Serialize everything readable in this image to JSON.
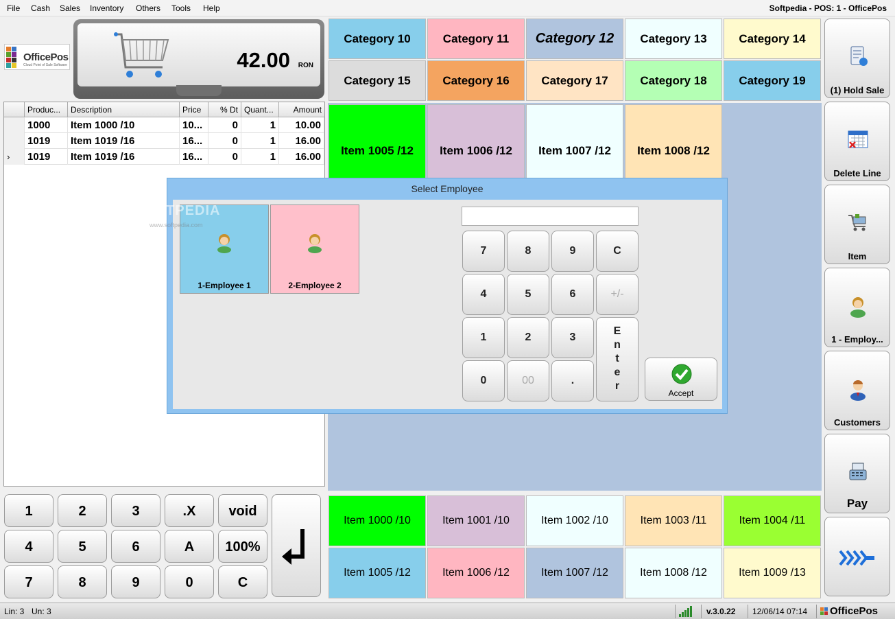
{
  "window_title": "Softpedia - POS: 1 - OfficePos",
  "menu": [
    {
      "label": "File"
    },
    {
      "label": "Cash"
    },
    {
      "label": "Sales"
    },
    {
      "label": "Inventory"
    },
    {
      "label": "Others"
    },
    {
      "label": "Tools"
    },
    {
      "label": "Help"
    }
  ],
  "logo": {
    "text": "OfficePos",
    "tagline": "Cloud Point of Sale Software"
  },
  "display": {
    "total": "42.00",
    "currency": "RON"
  },
  "grid": {
    "columns": [
      "Produc...",
      "Description",
      "Price",
      "% Dt",
      "Quant...",
      "Amount"
    ],
    "rows": [
      {
        "marker": "",
        "product": "1000",
        "description": "Item 1000 /10",
        "price": "10...",
        "discount": "0",
        "qty": "1",
        "amount": "10.00"
      },
      {
        "marker": "",
        "product": "1019",
        "description": "Item 1019 /16",
        "price": "16...",
        "discount": "0",
        "qty": "1",
        "amount": "16.00"
      },
      {
        "marker": "›",
        "product": "1019",
        "description": "Item 1019 /16",
        "price": "16...",
        "discount": "0",
        "qty": "1",
        "amount": "16.00"
      }
    ]
  },
  "keypad": [
    "1",
    "2",
    "3",
    ".X",
    "void",
    "4",
    "5",
    "6",
    "A",
    "100%",
    "7",
    "8",
    "9",
    "0",
    "C"
  ],
  "categories": [
    {
      "label": "Category 10",
      "color": "#87ceeb"
    },
    {
      "label": "Category 11",
      "color": "#ffb6c1"
    },
    {
      "label": "Category 12",
      "color": "#b0c4de"
    },
    {
      "label": "Category 13",
      "color": "#f0ffff"
    },
    {
      "label": "Category 14",
      "color": "#fffacd"
    },
    {
      "label": "Category 15",
      "color": "#dcdcdc"
    },
    {
      "label": "Category 16",
      "color": "#f4a460"
    },
    {
      "label": "Category 17",
      "color": "#ffe4c4"
    },
    {
      "label": "Category 18",
      "color": "#b4ffb4"
    },
    {
      "label": "Category 19",
      "color": "#87ceeb"
    }
  ],
  "items_top": [
    {
      "label": "Item 1005 /12",
      "color": "#00ff00"
    },
    {
      "label": "Item 1006 /12",
      "color": "#d8bfd8"
    },
    {
      "label": "Item 1007 /12",
      "color": "#f0ffff"
    },
    {
      "label": "Item 1008 /12",
      "color": "#ffe4b5"
    }
  ],
  "items_bottom": [
    {
      "label": "Item 1000 /10",
      "color": "#00ff00"
    },
    {
      "label": "Item 1001 /10",
      "color": "#d8bfd8"
    },
    {
      "label": "Item 1002 /10",
      "color": "#f0ffff"
    },
    {
      "label": "Item 1003 /11",
      "color": "#ffe4b5"
    },
    {
      "label": "Item 1004 /11",
      "color": "#9aff32"
    },
    {
      "label": "Item 1005 /12",
      "color": "#87ceeb"
    },
    {
      "label": "Item 1006 /12",
      "color": "#ffb6c1"
    },
    {
      "label": "Item 1007 /12",
      "color": "#b0c4de"
    },
    {
      "label": "Item 1008 /12",
      "color": "#f0ffff"
    },
    {
      "label": "Item 1009 /13",
      "color": "#fffacd"
    }
  ],
  "actions": [
    {
      "label": "(1) Hold Sale",
      "icon": "hold-sale-icon"
    },
    {
      "label": "Delete Line",
      "icon": "delete-line-icon"
    },
    {
      "label": "Item",
      "icon": "item-cart-icon"
    },
    {
      "label": "1 - Employ...",
      "icon": "employee-icon"
    },
    {
      "label": "Customers",
      "icon": "customer-icon"
    },
    {
      "label": "Pay",
      "icon": "cash-register-icon"
    },
    {
      "label": "",
      "icon": "next-page-arrows-icon"
    }
  ],
  "dialog": {
    "title": "Select Employee",
    "employees": [
      {
        "label": "1-Employee 1",
        "color": "#87ceeb"
      },
      {
        "label": "2-Employee 2",
        "color": "#ffc0cb"
      }
    ],
    "input_value": "",
    "numpad": [
      "7",
      "8",
      "9",
      "C",
      "4",
      "5",
      "6",
      "+/-",
      "1",
      "2",
      "3",
      "0",
      "00",
      "."
    ],
    "enter_label": "Enter",
    "accept_label": "Accept"
  },
  "watermark": {
    "text": "SOFTPEDIA",
    "sub": "www.softpedia.com"
  },
  "status": {
    "lines": "Lin: 3",
    "units": "Un: 3",
    "version": "v.3.0.22",
    "datetime": "12/06/14 07:14",
    "brand": "OfficePos"
  }
}
